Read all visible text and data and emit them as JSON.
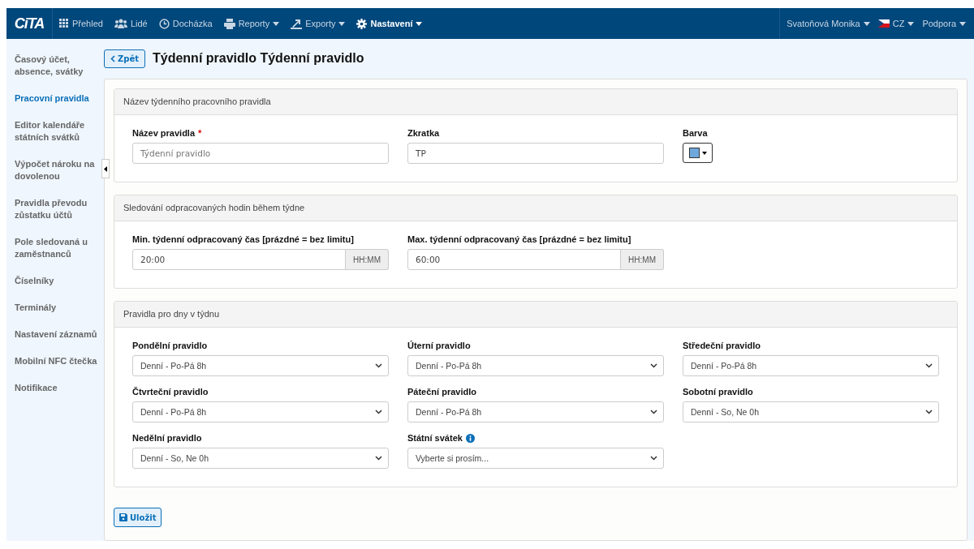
{
  "navbar": {
    "logo": "CiTA",
    "items": [
      {
        "label": "Přehled",
        "dropdown": false,
        "selected": false
      },
      {
        "label": "Lidé",
        "dropdown": false,
        "selected": false
      },
      {
        "label": "Docházka",
        "dropdown": false,
        "selected": false
      },
      {
        "label": "Reporty",
        "dropdown": true,
        "selected": false
      },
      {
        "label": "Exporty",
        "dropdown": true,
        "selected": false
      },
      {
        "label": "Nastavení",
        "dropdown": true,
        "selected": true
      }
    ],
    "right": [
      {
        "label": "Svatoňová Monika",
        "dropdown": true
      },
      {
        "label": "CZ",
        "dropdown": true
      },
      {
        "label": "Podpora",
        "dropdown": true
      }
    ]
  },
  "sidebar": {
    "items": [
      {
        "label": "Časový účet, absence, svátky",
        "selected": false
      },
      {
        "label": "Pracovní pravidla",
        "selected": true
      },
      {
        "label": "Editor kalendáře státních svátků",
        "selected": false
      },
      {
        "label": "Výpočet nároku na dovolenou",
        "selected": false
      },
      {
        "label": "Pravidla převodu zůstatku účtů",
        "selected": false
      },
      {
        "label": "Pole sledovaná u zaměstnanců",
        "selected": false
      },
      {
        "label": "Číselníky",
        "selected": false
      },
      {
        "label": "Terminály",
        "selected": false
      },
      {
        "label": "Nastavení záznamů",
        "selected": false
      },
      {
        "label": "Mobilní NFC čtečka",
        "selected": false
      },
      {
        "label": "Notifikace",
        "selected": false
      }
    ]
  },
  "back_button": "Zpět",
  "page_title": "Týdenní pravidlo Týdenní pravidlo",
  "sections": [
    {
      "title": "Název týdenního pracovního pravidla",
      "fields": [
        {
          "kind": "text",
          "label": "Název pravidla",
          "required_mark": "*",
          "placeholder": "Týdenní pravidlo"
        },
        {
          "kind": "text",
          "label": "Zkratka",
          "value": "TP"
        },
        {
          "kind": "color",
          "label": "Barva",
          "color": "#6fa8dc"
        }
      ]
    },
    {
      "title": "Sledování odpracovaných hodin během týdne",
      "fields": [
        {
          "kind": "time",
          "label": "Min. týdenní odpracovaný čas [prázdné = bez limitu]",
          "value": "20:00",
          "addon": "HH:MM"
        },
        {
          "kind": "time",
          "label": "Max. týdenní odpracovaný čas [prázdné = bez limitu]",
          "value": "60:00",
          "addon": "HH:MM"
        }
      ]
    },
    {
      "title": "Pravidla pro dny v týdnu",
      "fields": [
        {
          "kind": "select",
          "label": "Pondělní pravidlo",
          "value": "Denní - Po-Pá 8h"
        },
        {
          "kind": "select",
          "label": "Úterní pravidlo",
          "value": "Denní - Po-Pá 8h"
        },
        {
          "kind": "select",
          "label": "Středeční pravidlo",
          "value": "Denní - Po-Pá 8h"
        },
        {
          "kind": "select",
          "label": "Čtvrteční pravidlo",
          "value": "Denní - Po-Pá 8h"
        },
        {
          "kind": "select",
          "label": "Páteční pravidlo",
          "value": "Denní - Po-Pá 8h"
        },
        {
          "kind": "select",
          "label": "Sobotní pravidlo",
          "value": "Denní - So, Ne 0h"
        },
        {
          "kind": "select",
          "label": "Nedělní pravidlo",
          "value": "Denní - So, Ne 0h"
        },
        {
          "kind": "select",
          "label": "Státní svátek",
          "info": true,
          "placeholder": "Vyberte si prosím..."
        }
      ]
    }
  ],
  "save_button": "Uložit"
}
